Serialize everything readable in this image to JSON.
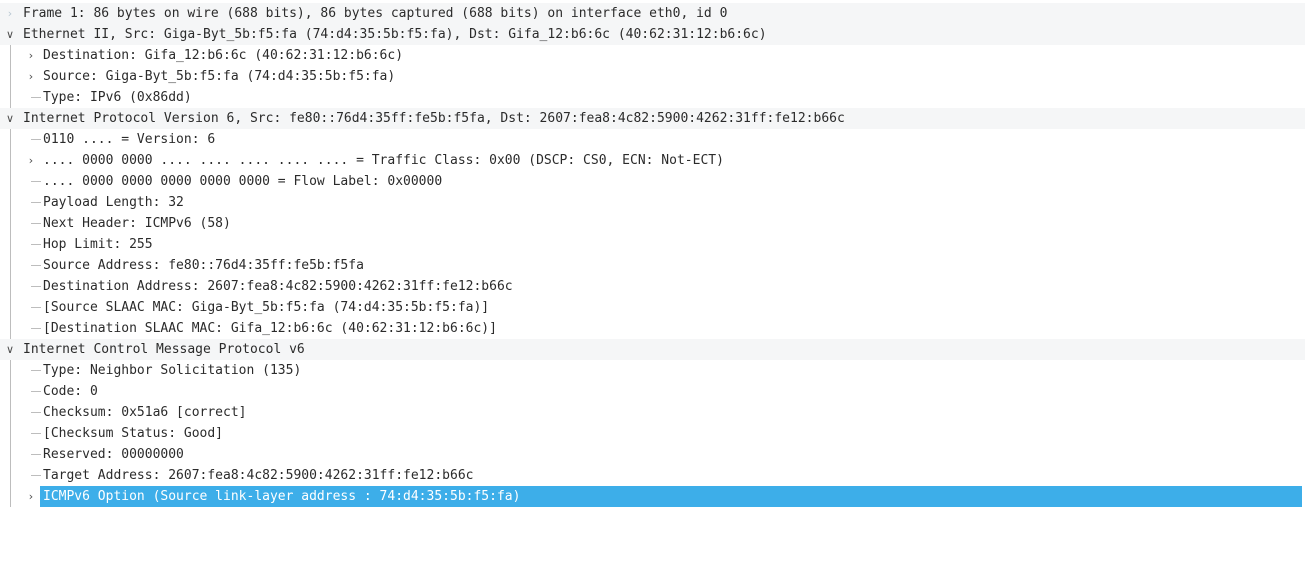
{
  "tree": {
    "frame": {
      "label": "Frame 1: 86 bytes on wire (688 bits), 86 bytes captured (688 bits) on interface eth0, id 0"
    },
    "ethernet": {
      "label": "Ethernet II, Src: Giga-Byt_5b:f5:fa (74:d4:35:5b:f5:fa), Dst: Gifa_12:b6:6c (40:62:31:12:b6:6c)",
      "children": [
        "Destination: Gifa_12:b6:6c (40:62:31:12:b6:6c)",
        "Source: Giga-Byt_5b:f5:fa (74:d4:35:5b:f5:fa)",
        "Type: IPv6 (0x86dd)"
      ]
    },
    "ipv6": {
      "label": "Internet Protocol Version 6, Src: fe80::76d4:35ff:fe5b:f5fa, Dst: 2607:fea8:4c82:5900:4262:31ff:fe12:b66c",
      "children": [
        "0110 .... = Version: 6",
        ".... 0000 0000 .... .... .... .... .... = Traffic Class: 0x00 (DSCP: CS0, ECN: Not-ECT)",
        ".... 0000 0000 0000 0000 0000 = Flow Label: 0x00000",
        "Payload Length: 32",
        "Next Header: ICMPv6 (58)",
        "Hop Limit: 255",
        "Source Address: fe80::76d4:35ff:fe5b:f5fa",
        "Destination Address: 2607:fea8:4c82:5900:4262:31ff:fe12:b66c",
        "[Source SLAAC MAC: Giga-Byt_5b:f5:fa (74:d4:35:5b:f5:fa)]",
        "[Destination SLAAC MAC: Gifa_12:b6:6c (40:62:31:12:b6:6c)]"
      ]
    },
    "icmpv6": {
      "label": "Internet Control Message Protocol v6",
      "children": [
        "Type: Neighbor Solicitation (135)",
        "Code: 0",
        "Checksum: 0x51a6 [correct]",
        "[Checksum Status: Good]",
        "Reserved: 00000000",
        "Target Address: 2607:fea8:4c82:5900:4262:31ff:fe12:b66c",
        "ICMPv6 Option (Source link-layer address : 74:d4:35:5b:f5:fa)"
      ]
    }
  },
  "icons": {
    "expand": "chevron-right-icon",
    "collapse": "chevron-down-icon"
  },
  "colors": {
    "selection": "#3daee9",
    "section_bg": "#f5f6f7",
    "text": "#2b2b2b"
  }
}
